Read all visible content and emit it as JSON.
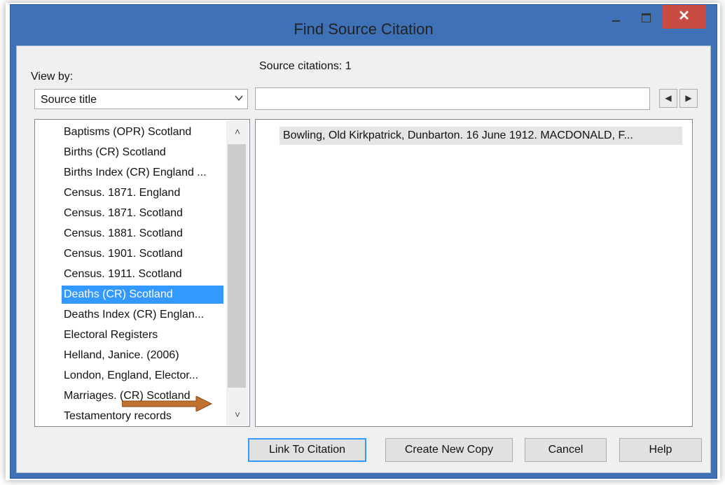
{
  "window": {
    "title": "Find Source Citation",
    "close_glyph": "✕"
  },
  "view_by": {
    "label": "View by:",
    "selected": "Source title"
  },
  "source_count": "Source citations: 1",
  "search": {
    "value": "",
    "placeholder": ""
  },
  "nav": {
    "prev_glyph": "◀",
    "next_glyph": "▶"
  },
  "source_list": {
    "items": [
      "Baptisms (OPR) Scotland",
      "Births (CR) Scotland",
      "Births Index (CR) England ...",
      "Census. 1871. England",
      "Census. 1871. Scotland",
      "Census. 1881. Scotland",
      "Census. 1901. Scotland",
      "Census. 1911. Scotland",
      "Deaths (CR) Scotland",
      "Deaths Index (CR) Englan...",
      "Electoral Registers",
      "Helland, Janice. (2006)",
      "London, England, Elector...",
      "Marriages. (CR) Scotland",
      "Testamentory records"
    ],
    "selected": "Deaths (CR) Scotland",
    "scroll_up_glyph": "˄",
    "scroll_down_glyph": "˅"
  },
  "citations": [
    "Bowling, Old Kirkpatrick, Dunbarton. 16 June 1912. MACDONALD, F..."
  ],
  "buttons": {
    "link": "Link To Citation",
    "create": "Create New Copy",
    "cancel": "Cancel",
    "help": "Help"
  },
  "colors": {
    "selection": "#3399ff",
    "close_button": "#c94c43",
    "annotation_arrow": "#c0722e"
  }
}
